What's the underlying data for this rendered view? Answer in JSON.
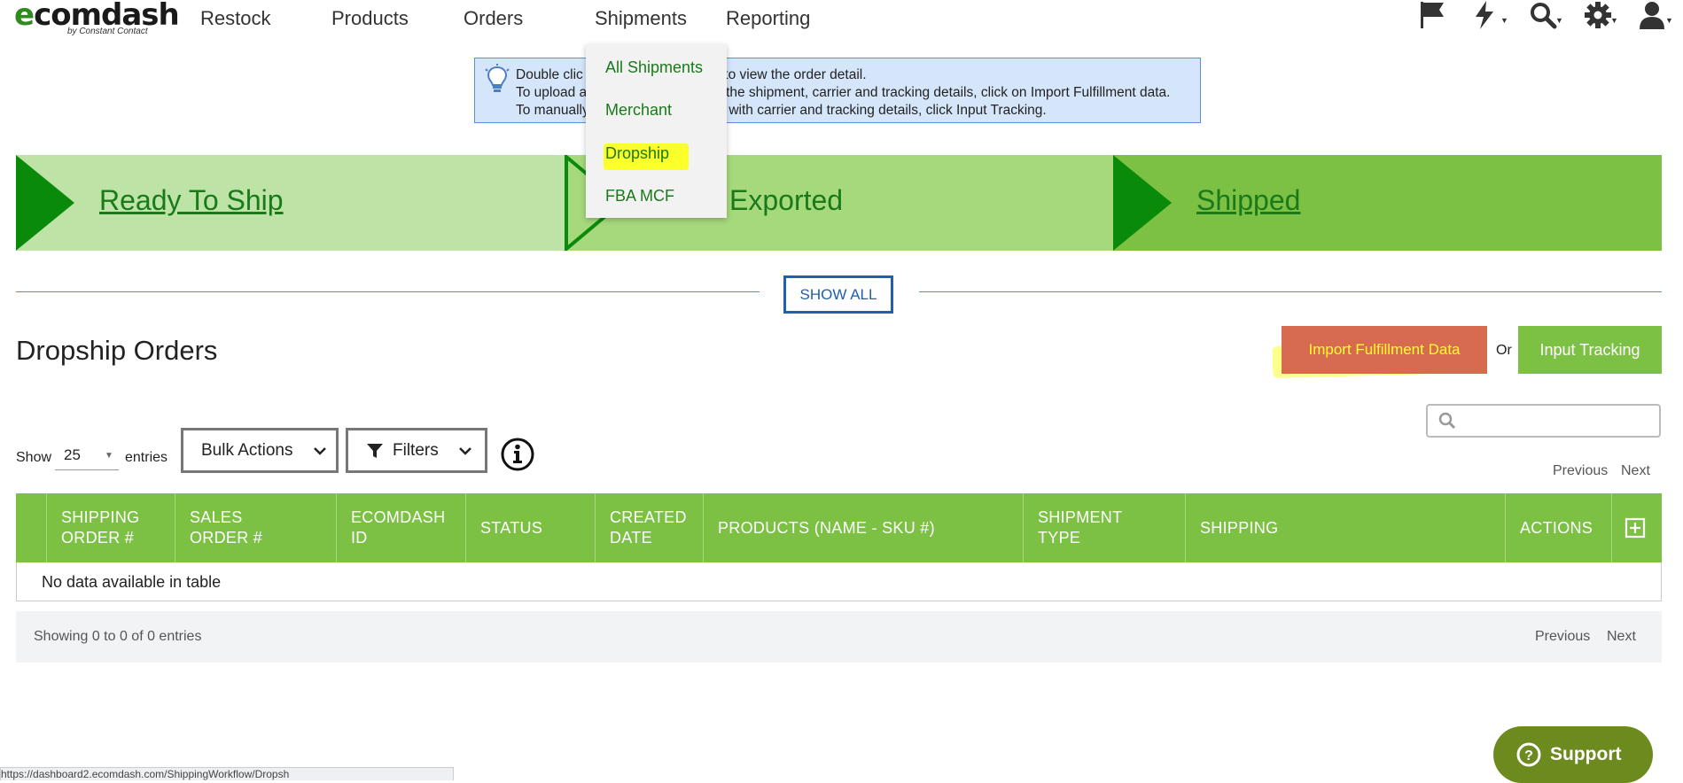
{
  "logo": {
    "main": "ecomdash",
    "sub": "by Constant Contact"
  },
  "nav": {
    "items": [
      "Restock",
      "Products",
      "Orders",
      "Shipments",
      "Reporting"
    ],
    "icons": [
      "flag-icon",
      "bolt-icon",
      "search-icon",
      "gear-icon",
      "user-icon"
    ]
  },
  "info": {
    "lines": [
      "Double click on a row in the order to view the order detail.",
      "To upload a file matching the shipment, carrier and tracking details, click on Import Fulfillment data.",
      "To manually update a shipment with carrier and tracking details, click Input Tracking."
    ],
    "visible_lines": [
      [
        "Double clic",
        "r to view the order detail."
      ],
      [
        "To upload a",
        "h the shipment, carrier and tracking details, click on Import Fulfillment data."
      ],
      [
        "To manually",
        "t with carrier and tracking details, click Input Tracking."
      ]
    ]
  },
  "stages": {
    "ready": "Ready To Ship",
    "exported": "Exported",
    "shipped": "Shipped"
  },
  "show_all": "SHOW ALL",
  "page_title": "Dropship Orders",
  "actions": {
    "import": "Import Fulfillment Data",
    "or": "Or",
    "input_tracking": "Input Tracking"
  },
  "table_controls": {
    "show": "Show",
    "entries_value": "25",
    "entries": "entries",
    "bulk_actions": "Bulk Actions",
    "filters": "Filters",
    "previous": "Previous",
    "next": "Next"
  },
  "table": {
    "columns": [
      {
        "line1": "SHIPPING",
        "line2": "ORDER #"
      },
      {
        "line1": "SALES",
        "line2": "ORDER #"
      },
      {
        "line1": "ECOMDASH",
        "line2": "ID"
      },
      {
        "line1": "STATUS",
        "line2": ""
      },
      {
        "line1": "CREATED",
        "line2": "DATE"
      },
      {
        "line1": "PRODUCTS (NAME - SKU #)",
        "line2": ""
      },
      {
        "line1": "SHIPMENT",
        "line2": "TYPE"
      },
      {
        "line1": "SHIPPING",
        "line2": ""
      },
      {
        "line1": "ACTIONS",
        "line2": ""
      }
    ],
    "empty": "No data available in table",
    "summary": "Showing 0 to 0 of 0 entries"
  },
  "shipments_menu": [
    "All Shipments",
    "Merchant",
    "Dropship",
    "FBA MCF"
  ],
  "support": "Support",
  "status_url": "https://dashboard2.ecomdash.com/ShippingWorkflow/Dropsh",
  "colors": {
    "green": "#7cc144",
    "dark_green": "#0a8a0a",
    "import_bg": "#d66b4f",
    "highlight": "#fbff2a",
    "info_bg": "#d5e6fb"
  }
}
